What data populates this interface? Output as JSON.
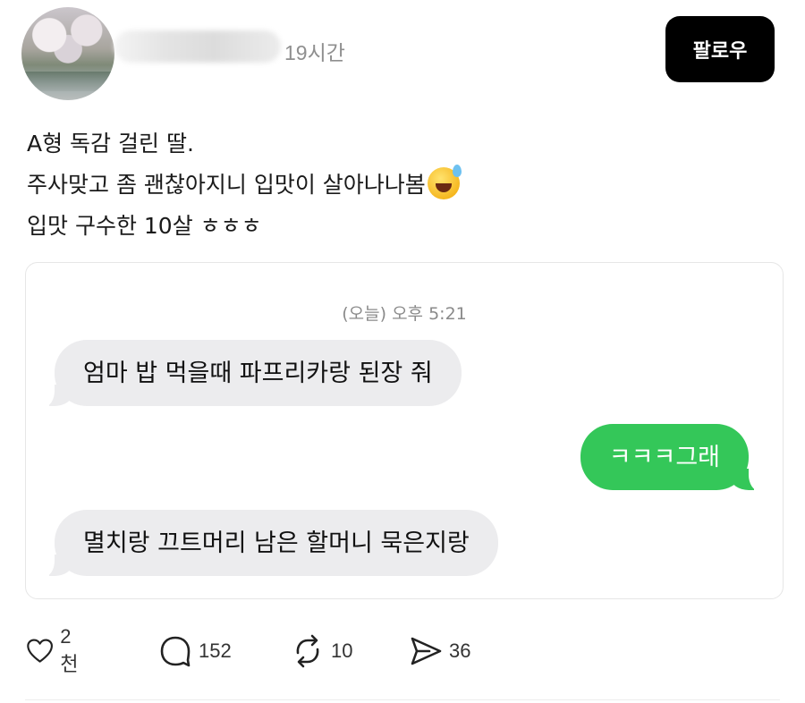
{
  "header": {
    "time": "19시간",
    "follow_label": "팔로우"
  },
  "post": {
    "lines": [
      "A형 독감 걸린 딸.",
      "주사맞고 좀 괜찮아지니 입맛이 살아나나봄",
      "입맛 구수한 10살 ㅎㅎㅎ"
    ],
    "emoji": "sweat-smile-emoji"
  },
  "chat": {
    "timestamp": "(오늘) 오후 5:21",
    "messages": [
      {
        "side": "received",
        "text": "엄마 밥 먹을때 파프리카랑 된장 줘"
      },
      {
        "side": "sent",
        "text": "ㅋㅋㅋ그래"
      },
      {
        "side": "received",
        "text": "멸치랑 끄트머리 남은 할머니 묵은지랑"
      }
    ]
  },
  "actions": {
    "likes": "2천",
    "replies": "152",
    "reposts": "10",
    "shares": "36"
  },
  "colors": {
    "follow_bg": "#000000",
    "sent_bubble": "#34c759",
    "received_bubble": "#ececee"
  }
}
